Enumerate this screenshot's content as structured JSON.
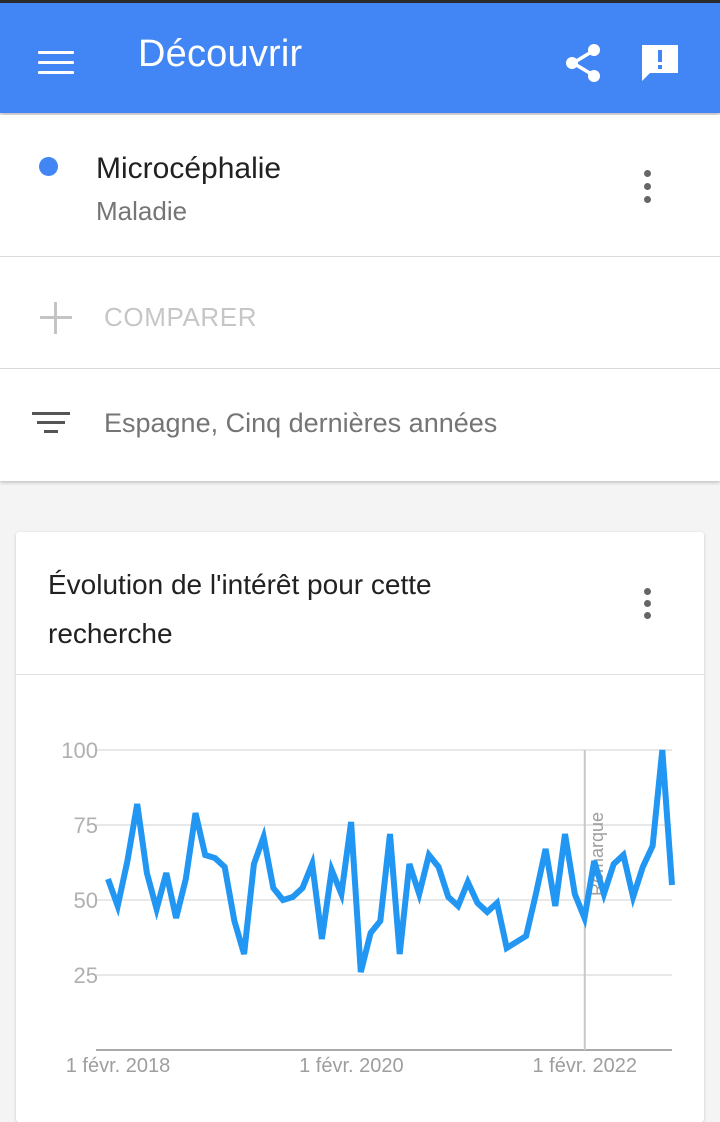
{
  "app_bar": {
    "title": "Découvrir",
    "color": "#4285f4",
    "icons": [
      "menu-icon",
      "share-icon",
      "feedback-icon"
    ]
  },
  "term": {
    "name": "Microcéphalie",
    "type": "Maladie",
    "dot_color": "#4285f4"
  },
  "compare": {
    "label": "COMPARER"
  },
  "filter": {
    "label": "Espagne, Cinq dernières années"
  },
  "chart_card": {
    "title": "Évolution de l'intérêt pour cette recherche"
  },
  "chart_data": {
    "type": "line",
    "series": [
      {
        "color": "#2196f3",
        "values": [
          57,
          48,
          63,
          82,
          59,
          47,
          59,
          44,
          57,
          79,
          65,
          64,
          61,
          43,
          32,
          62,
          71,
          54,
          50,
          51,
          54,
          62,
          37,
          60,
          52,
          76,
          26,
          39,
          43,
          72,
          32,
          62,
          52,
          65,
          61,
          51,
          48,
          56,
          49,
          46,
          49,
          34,
          36,
          38,
          52,
          67,
          48,
          72,
          52,
          44,
          63,
          52,
          62,
          65,
          51,
          61,
          68,
          100,
          55
        ]
      }
    ],
    "x_tick_labels": [
      "1 févr. 2018",
      "1 févr. 2020",
      "1 févr. 2022"
    ],
    "x_tick_indices": [
      0,
      24,
      48
    ],
    "y_ticks": [
      100,
      75,
      50,
      25
    ],
    "ylim": [
      0,
      100
    ],
    "annotation": {
      "label": "Remarque",
      "index": 48
    },
    "grid": true
  }
}
